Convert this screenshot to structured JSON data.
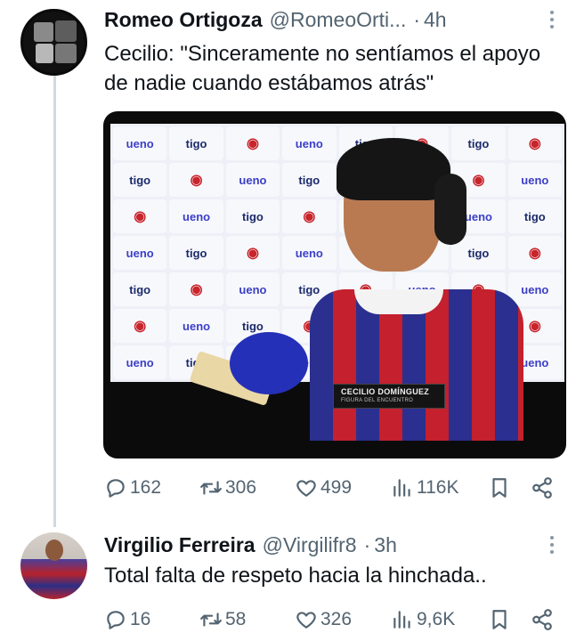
{
  "tweets": [
    {
      "author_name": "Romeo Ortigoza",
      "handle": "@RomeoOrti...",
      "separator": "·",
      "time": "4h",
      "text": "Cecilio: \"Sinceramente no sentíamos el apoyo de nadie cuando estábamos atrás\"",
      "media": {
        "sponsor_tigo": "tigo",
        "sponsor_ueno": "ueno",
        "caption_name": "CECILIO DOMÍNGUEZ",
        "caption_role": "FIGURA DEL ENCUENTRO"
      },
      "stats": {
        "replies": "162",
        "retweets": "306",
        "likes": "499",
        "views": "116K"
      }
    },
    {
      "author_name": "Virgilio Ferreira",
      "handle": "@Virgilifr8",
      "separator": "·",
      "time": "3h",
      "text": "Total falta de respeto hacia la hinchada..",
      "stats": {
        "replies": "16",
        "retweets": "58",
        "likes": "326",
        "views": "9,6K"
      }
    }
  ],
  "icons": {
    "reply": "reply-icon",
    "retweet": "retweet-icon",
    "like": "heart-icon",
    "views": "views-icon",
    "bookmark": "bookmark-icon",
    "share": "share-icon",
    "more": "more-icon"
  },
  "colors": {
    "text": "#0f1419",
    "secondary": "#536471",
    "thread_line": "#cfd9de"
  }
}
